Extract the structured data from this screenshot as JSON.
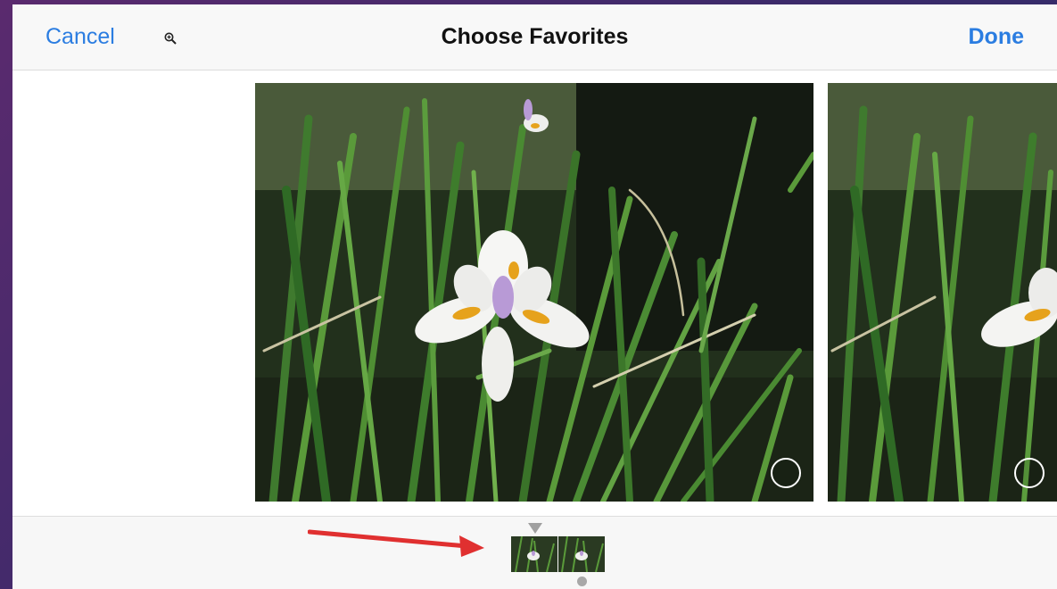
{
  "navbar": {
    "cancel_label": "Cancel",
    "title": "Choose Favorites",
    "done_label": "Done",
    "zoom_icon": "zoom-in-icon"
  },
  "photos": [
    {
      "name": "iris-photo-main",
      "selected": false
    },
    {
      "name": "iris-photo-next",
      "selected": false
    }
  ],
  "filmstrip": {
    "thumb_count": 2,
    "current_index": 0
  },
  "colors": {
    "accent": "#2b7de1",
    "annotation": "#e03030"
  }
}
